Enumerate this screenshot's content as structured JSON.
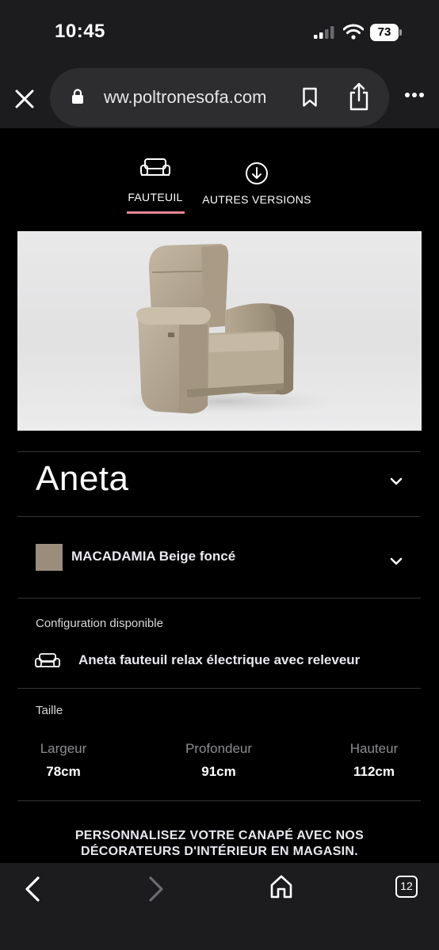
{
  "status_bar": {
    "time": "10:45",
    "battery": "73"
  },
  "browser": {
    "url": "ww.poltronesofa.com",
    "tab_count": "12"
  },
  "tabs": [
    {
      "label": "FAUTEUIL",
      "active": true,
      "icon": "armchair-icon"
    },
    {
      "label": "AUTRES VERSIONS",
      "active": false,
      "icon": "download-circle-icon"
    }
  ],
  "product": {
    "name": "Aneta",
    "image_alt": "recliner-armchair-image",
    "color": {
      "name": "MACADAMIA Beige foncé",
      "swatch": "#9a8d7b"
    },
    "configuration": {
      "label": "Configuration disponible",
      "name": "Aneta fauteuil relax électrique avec releveur"
    },
    "size": {
      "label": "Taille",
      "dimensions": [
        {
          "label": "Largeur",
          "value": "78cm"
        },
        {
          "label": "Profondeur",
          "value": "91cm"
        },
        {
          "label": "Hauteur",
          "value": "112cm"
        }
      ]
    }
  },
  "cta": {
    "line1": "PERSONNALISEZ VOTRE CANAPÉ AVEC NOS",
    "line2": "DÉCORATEURS D'INTÉRIEUR EN MAGASIN."
  },
  "colors": {
    "accent": "#e88892",
    "background": "#000000",
    "bar": "#1c1c1e"
  }
}
